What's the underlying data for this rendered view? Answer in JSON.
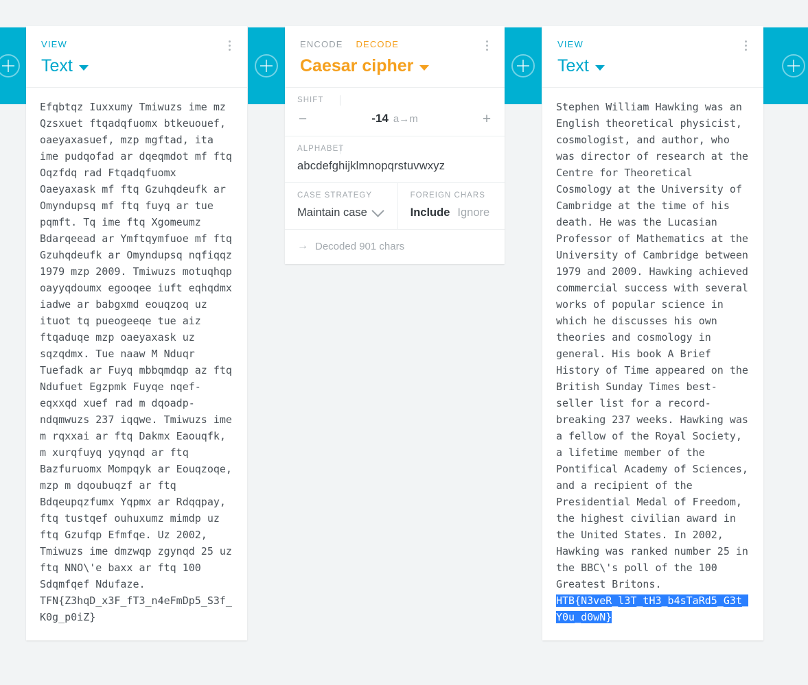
{
  "theme": {
    "accent_blue": "#00b0d2",
    "accent_orange": "#f5a01e",
    "selection_blue": "#2a7fff",
    "page_background": "#f2f4f5",
    "card_background": "#ffffff"
  },
  "connectors": [
    {
      "name": "add-brick-left-edge",
      "icon": "plus-circle-icon"
    },
    {
      "name": "add-brick-between-1",
      "icon": "plus-circle-icon"
    },
    {
      "name": "add-brick-between-2",
      "icon": "plus-circle-icon"
    },
    {
      "name": "add-brick-right-edge",
      "icon": "plus-circle-icon"
    }
  ],
  "viewer_left": {
    "meta_label": "VIEW",
    "title": "Text",
    "menu_icon": "kebab-menu-icon",
    "content": "Efqbtqz Iuxxumy Tmiwuzs ime mz Qzsxuet ftqadqfuomx btkeuouef, oaeyaxasuef, mzp mgftad, ita ime pudqofad ar dqeqmdot mf ftq Oqzfdq rad Ftqadqfuomx Oaeyaxask mf ftq Gzuhqdeufk ar Omyndupsq mf ftq fuyq ar tue pqmft. Tq ime ftq Xgomeumz Bdarqeead ar Ymftqymfuoe mf ftq Gzuhqdeufk ar Omyndupsq nqfiqqz 1979 mzp 2009. Tmiwuzs motuqhqp oayyqdoumx egooqee iuft eqhqdmx iadwe ar babgxmd eouqzoq uz ituot tq pueogeeqe tue aiz ftqaduqe mzp oaeyaxask uz sqzqdmx. Tue naaw M Nduqr Tuefadk ar Fuyq mbbqmdqp az ftq Ndufuet Egzpmk Fuyqe nqef-eqxxqd xuef rad m dqoadp-ndqmwuzs 237 iqqwe. Tmiwuzs ime m rqxxai ar ftq Dakmx Eaouqfk, m xurqfuyq yqynqd ar ftq Bazfuruomx Mompqyk ar Eouqzoqe, mzp m dqoubuqzf ar ftq Bdqeupqzfumx Yqpmx ar Rdqqpay, ftq tustqef ouhuxumz mimdp uz ftq Gzufqp Efmfqe. Uz 2002, Tmiwuzs ime dmzwqp zgynqd 25 uz ftq NNO\\'e baxx ar ftq 100 Sdqmfqef Ndufaze. TFN{Z3hqD_x3F_fT3_n4eFmDp5_S3f_K0g_p0iZ}"
  },
  "encoder": {
    "tabs": [
      {
        "label": "ENCODE",
        "active": false
      },
      {
        "label": "DECODE",
        "active": true
      }
    ],
    "title": "Caesar cipher",
    "menu_icon": "kebab-menu-icon",
    "settings": {
      "shift": {
        "label": "SHIFT",
        "value": "-14",
        "hint": "a→m",
        "decrement": "−",
        "increment": "+"
      },
      "alphabet": {
        "label": "ALPHABET",
        "value": "abcdefghijklmnopqrstuvwxyz"
      },
      "case_strategy": {
        "label": "CASE STRATEGY",
        "value": "Maintain case"
      },
      "foreign_chars": {
        "label": "FOREIGN CHARS",
        "options": [
          {
            "label": "Include",
            "selected": true
          },
          {
            "label": "Ignore",
            "selected": false
          }
        ]
      }
    },
    "status": {
      "arrow": "→",
      "text": "Decoded 901 chars"
    }
  },
  "viewer_right": {
    "meta_label": "VIEW",
    "title": "Text",
    "menu_icon": "kebab-menu-icon",
    "content_before_selection": "Stephen William Hawking was an English theoretical physicist, cosmologist, and author, who was director of research at the Centre for Theoretical Cosmology at the University of Cambridge at the time of his death. He was the Lucasian Professor of Mathematics at the University of Cambridge between 1979 and 2009. Hawking achieved commercial success with several works of popular science in which he discusses his own theories and cosmology in general. His book A Brief History of Time appeared on the British Sunday Times best-seller list for a record-breaking 237 weeks. Hawking was a fellow of the Royal Society, a lifetime member of the Pontifical Academy of Sciences, and a recipient of the Presidential Medal of Freedom, the highest civilian award in the United States. In 2002, Hawking was ranked number 25 in the BBC\\'s poll of the 100 Greatest Britons. ",
    "selected_text": "HTB{N3veR_l3T_tH3_b4sTaRd5_G3t_Y0u_d0wN}"
  }
}
